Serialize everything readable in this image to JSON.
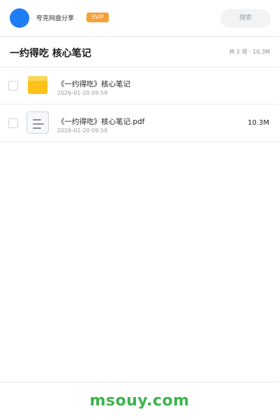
{
  "header": {
    "username": "夸克网盘分享",
    "badge": "SVIP",
    "search_placeholder": "搜索"
  },
  "folder": {
    "title": "一约得吃 核心笔记",
    "meta": "共 2 项 · 10.3M"
  },
  "files": [
    {
      "name": "《一约得吃》核心笔记",
      "date": "2026-01-20 09:59",
      "size": "",
      "icon": "folder-icon"
    },
    {
      "name": "《一约得吃》核心笔记.pdf",
      "date": "2026-01-20 09:59",
      "size": "10.3M",
      "icon": "document-icon"
    }
  ],
  "footer": {
    "watermark": "msouy.com"
  },
  "colors": {
    "avatar": "#1f7ef5",
    "badge": "#f6a03b",
    "folder": "#fdc21a",
    "watermark": "#3cb34a"
  }
}
